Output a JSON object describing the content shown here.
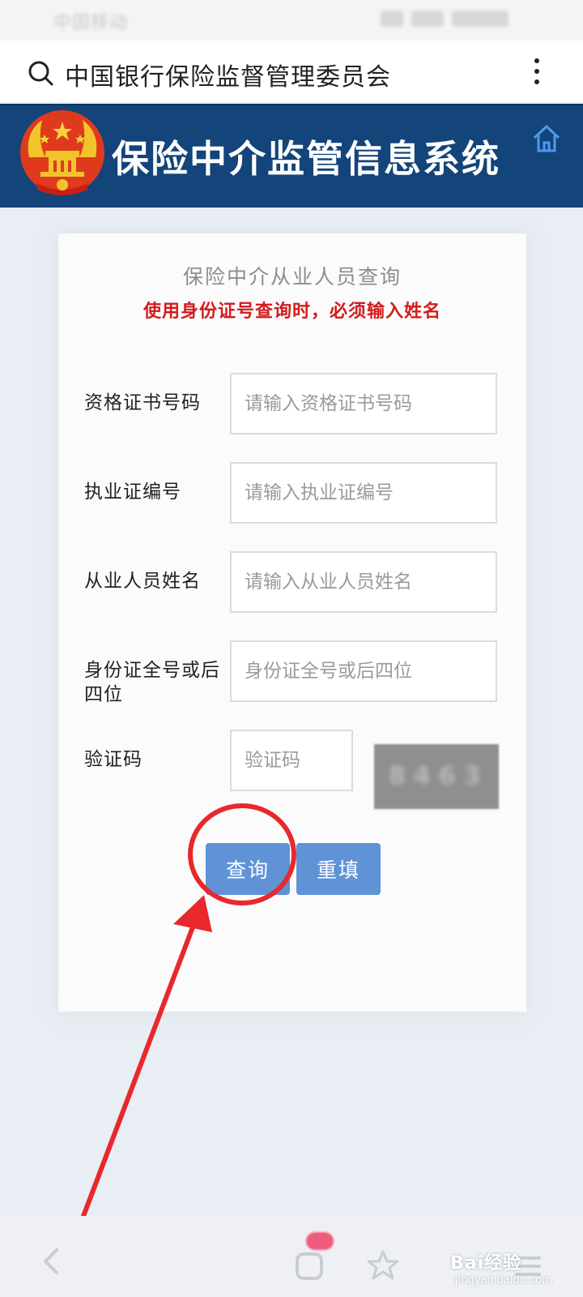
{
  "status_bar": {
    "carrier": "中国移动"
  },
  "browser": {
    "site_title": "中国银行保险监督管理委员会"
  },
  "header": {
    "title": "保险中介监管信息系统"
  },
  "form": {
    "title": "保险中介从业人员查询",
    "warning": "使用身份证号查询时，必须输入姓名",
    "fields": [
      {
        "label": "资格证书号码",
        "placeholder": "请输入资格证书号码"
      },
      {
        "label": "执业证编号",
        "placeholder": "请输入执业证编号"
      },
      {
        "label": "从业人员姓名",
        "placeholder": "请输入从业人员姓名"
      },
      {
        "label": "身份证全号或后四位",
        "placeholder": "身份证全号或后四位"
      },
      {
        "label": "验证码",
        "placeholder": "验证码"
      }
    ],
    "captcha_text": "8463",
    "query_button": "查询",
    "reset_button": "重填"
  },
  "watermark": {
    "brand": "Bai经验",
    "url": "jingyan.baidu.com"
  },
  "colors": {
    "header_bg": "#13447a",
    "warning": "#d21b1b",
    "button": "#5f93d6",
    "annotation": "#e8282c"
  }
}
